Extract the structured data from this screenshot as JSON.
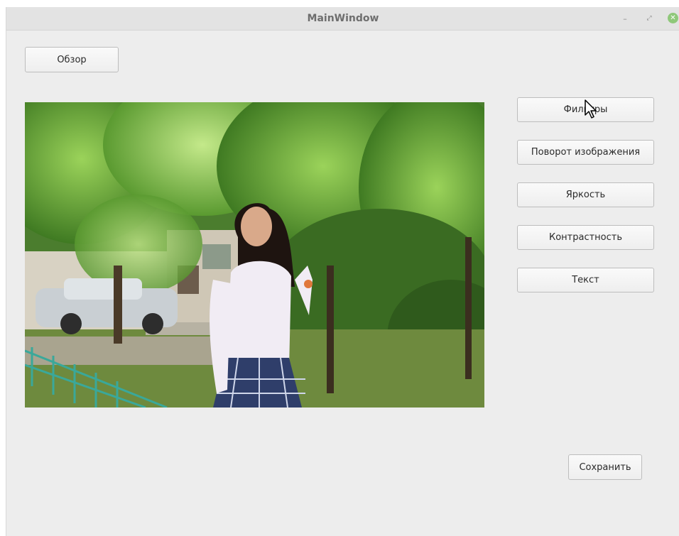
{
  "window": {
    "title": "MainWindow",
    "controls": {
      "minimize": "–",
      "maximize": "⤢",
      "close": "✕"
    }
  },
  "buttons": {
    "browse": "Обзор",
    "filters": "Фильтры",
    "rotate": "Поворот изображения",
    "brightness": "Яркость",
    "contrast": "Контрастность",
    "text": "Текст",
    "save": "Сохранить"
  },
  "image": {
    "description_icon": "photo-girl-in-park"
  },
  "colors": {
    "window_bg": "#ededed",
    "titlebar_bg": "#e3e3e3",
    "close_button": "#8fc87a"
  }
}
